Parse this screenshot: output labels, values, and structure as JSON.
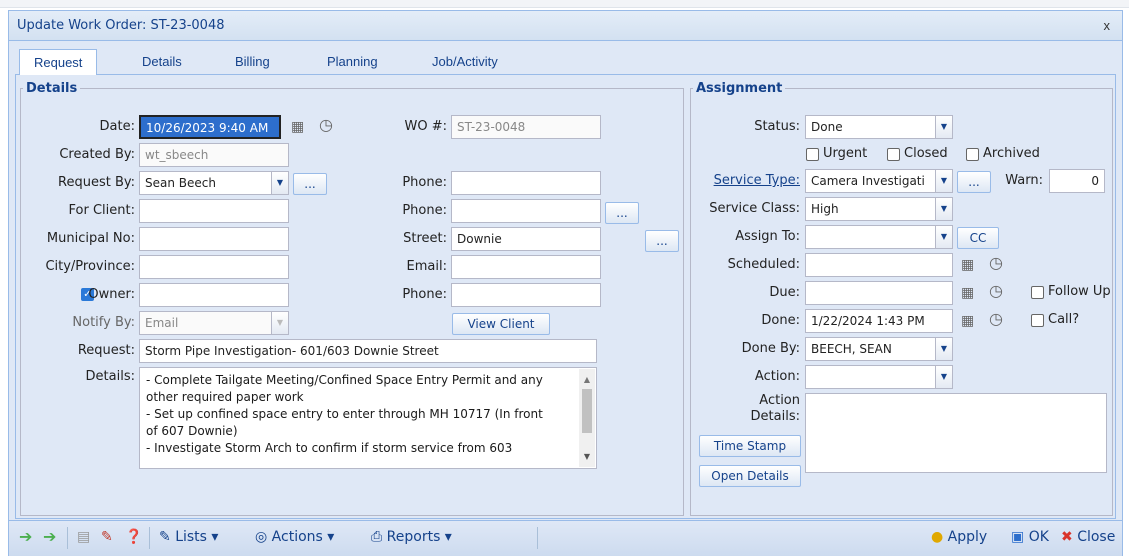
{
  "window": {
    "title": "Update Work Order: ST-23-0048",
    "close": "x"
  },
  "tabs": [
    "Request",
    "Details",
    "Billing",
    "Planning",
    "Job/Activity"
  ],
  "details": {
    "legend": "Details",
    "date_label": "Date:",
    "date_value": "10/26/2023 9:40 AM",
    "wo_label": "WO #:",
    "wo_value": "ST-23-0048",
    "created_label": "Created By:",
    "created_value": "wt_sbeech",
    "request_by_label": "Request By:",
    "request_by_value": "Sean Beech",
    "ellipsis": "...",
    "phone_label": "Phone:",
    "for_client_label": "For Client:",
    "municipal_label": "Municipal No:",
    "street_label": "Street:",
    "street_value": "Downie",
    "city_label": "City/Province:",
    "email_label": "Email:",
    "owner_label": "Owner:",
    "notify_label": "Notify By:",
    "notify_value": "Email",
    "view_client": "View Client",
    "request_label": "Request:",
    "request_value": "Storm Pipe Investigation- 601/603 Downie Street",
    "details_label": "Details:",
    "details_lines": [
      "- Complete Tailgate Meeting/Confined Space Entry Permit and any",
      "other required paper work",
      "- Set up confined space entry to enter through MH 10717 (In front",
      "of 607 Downie)",
      "- Investigate Storm Arch to confirm if storm service from 603"
    ]
  },
  "assignment": {
    "legend": "Assignment",
    "status_label": "Status:",
    "status_value": "Done",
    "urgent": "Urgent",
    "closed": "Closed",
    "archived": "Archived",
    "service_type_label": "Service Type:",
    "service_type_value": "Camera Investigati",
    "warn_label": "Warn:",
    "warn_value": "0",
    "service_class_label": "Service Class:",
    "service_class_value": "High",
    "assign_label": "Assign To:",
    "cc": "CC",
    "scheduled_label": "Scheduled:",
    "due_label": "Due:",
    "follow_up": "Follow Up",
    "done_label": "Done:",
    "done_value": "1/22/2024 1:43 PM",
    "call": "Call?",
    "done_by_label": "Done By:",
    "done_by_value": "BEECH, SEAN",
    "action_label": "Action:",
    "action_details_label_1": "Action",
    "action_details_label_2": "Details:",
    "time_stamp": "Time Stamp",
    "open_details": "Open Details"
  },
  "toolbar": {
    "lists": "Lists",
    "actions": "Actions",
    "reports": "Reports",
    "apply": "Apply",
    "ok": "OK",
    "close": "Close"
  },
  "colors": {
    "accent": "#15428b",
    "panel": "#dfe8f6",
    "border": "#99bbe8",
    "selection": "#2d6ecc"
  }
}
